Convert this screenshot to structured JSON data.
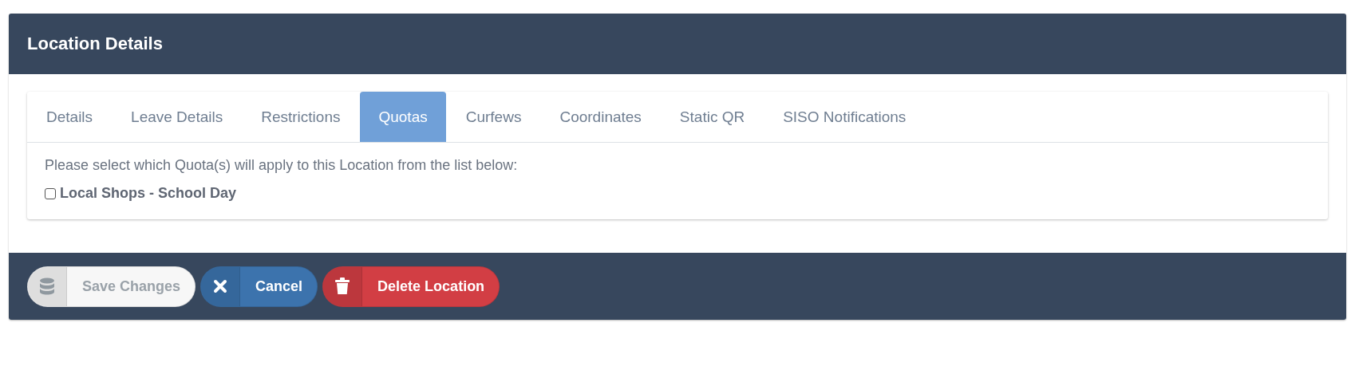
{
  "window": {
    "title": "Location Details"
  },
  "tabs": [
    {
      "label": "Details",
      "selected": false
    },
    {
      "label": "Leave Details",
      "selected": false
    },
    {
      "label": "Restrictions",
      "selected": false
    },
    {
      "label": "Quotas",
      "selected": true
    },
    {
      "label": "Curfews",
      "selected": false
    },
    {
      "label": "Coordinates",
      "selected": false
    },
    {
      "label": "Static QR",
      "selected": false
    },
    {
      "label": "SISO Notifications",
      "selected": false
    }
  ],
  "instruction": "Please select which Quota(s) will apply to this Location from the list below:",
  "quotas": [
    {
      "label": "Local Shops - School Day",
      "checked": false
    }
  ],
  "buttons": [
    {
      "label": "Save Changes",
      "kind": "save",
      "disabled": true
    },
    {
      "label": "Cancel",
      "kind": "cancel",
      "disabled": false
    },
    {
      "label": "Delete Location",
      "kind": "delete",
      "disabled": false
    }
  ]
}
